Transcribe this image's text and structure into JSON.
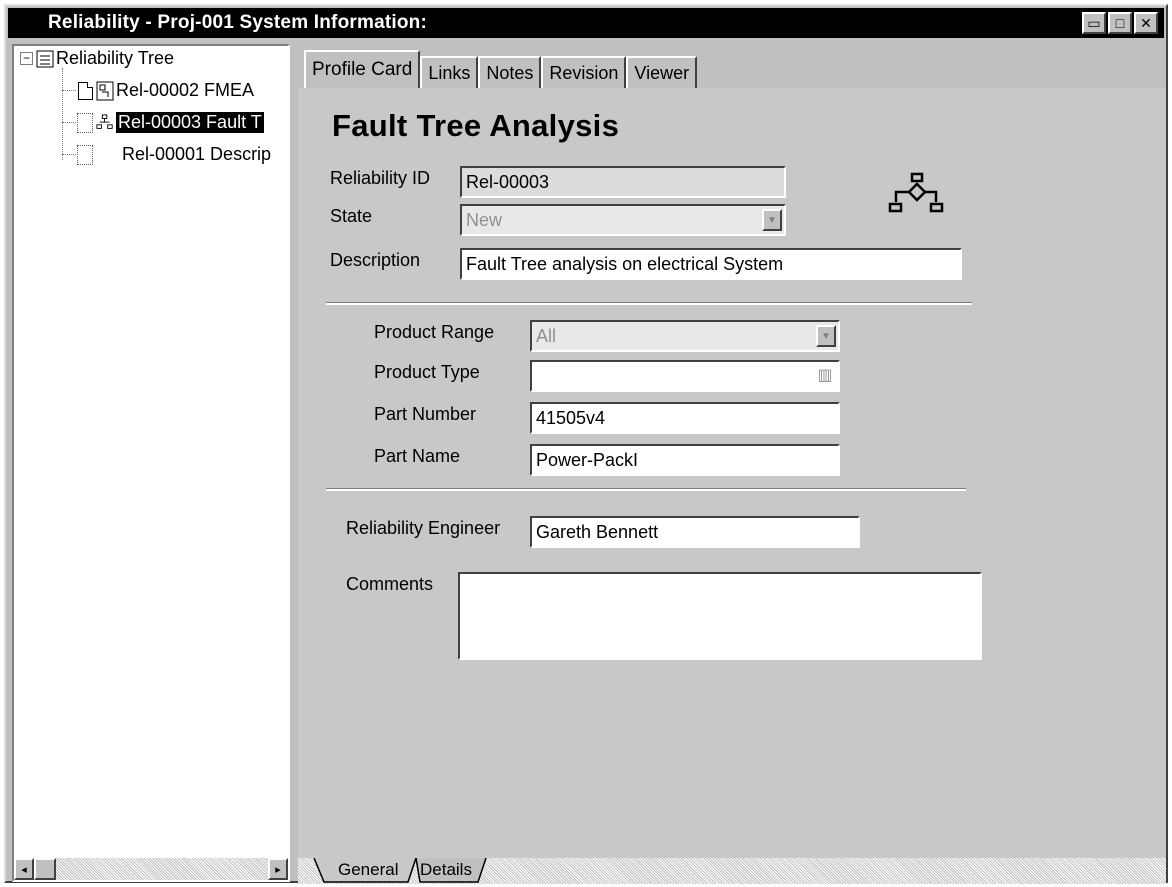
{
  "window": {
    "title": "Reliability - Proj-001 System Information:",
    "buttons": {
      "minimize": "▭",
      "maximize": "□",
      "close": "✕"
    }
  },
  "tree": {
    "root_label": "Reliability Tree",
    "expander": "⊟",
    "items": [
      {
        "label": "Rel-00002 FMEA",
        "icon": "document-icon",
        "selected": false
      },
      {
        "label": "Rel-00003 Fault T",
        "icon": "fault-tree-icon",
        "selected": true
      },
      {
        "label": "Rel-00001 Descrip",
        "icon": "none",
        "selected": false
      }
    ],
    "scroll_left": "◂",
    "scroll_right": "▸"
  },
  "tabs": [
    {
      "label": "Profile Card",
      "active": true
    },
    {
      "label": "Links",
      "active": false
    },
    {
      "label": "Notes",
      "active": false
    },
    {
      "label": "Revision",
      "active": false
    },
    {
      "label": "Viewer",
      "active": false
    }
  ],
  "profile": {
    "heading": "Fault Tree Analysis",
    "reliability_id": {
      "label": "Reliability ID",
      "value": "Rel-00003"
    },
    "state": {
      "label": "State",
      "value": "New"
    },
    "description": {
      "label": "Description",
      "value": "Fault Tree analysis on electrical System"
    },
    "product_range": {
      "label": "Product Range",
      "value": "All"
    },
    "product_type": {
      "label": "Product Type",
      "value": ""
    },
    "part_number": {
      "label": "Part Number",
      "value": "41505v4"
    },
    "part_name": {
      "label": "Part Name",
      "value": "Power-PackI"
    },
    "reliability_engineer": {
      "label": "Reliability Engineer",
      "value": "Gareth Bennett"
    },
    "comments": {
      "label": "Comments",
      "value": ""
    }
  },
  "bottom_tabs": [
    {
      "label": "General",
      "active": true
    },
    {
      "label": "Details",
      "active": false
    }
  ],
  "colors": {
    "titlebar": "#000000",
    "selection": "#000000",
    "face": "#c0c0c0"
  }
}
